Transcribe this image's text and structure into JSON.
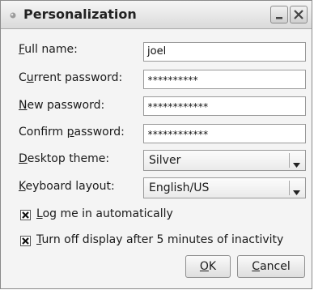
{
  "window": {
    "title": "Personalization",
    "icons": {
      "app": "bullet-icon",
      "minimize": "minimize-icon",
      "close": "close-icon"
    }
  },
  "form": {
    "full_name": {
      "label_mnemonic": "F",
      "label_rest": "ull name:",
      "value": "joel"
    },
    "current_password": {
      "label_pre": "C",
      "label_mnemonic": "u",
      "label_rest": "rrent password:",
      "value": "**********"
    },
    "new_password": {
      "label_mnemonic": "N",
      "label_rest": "ew password:",
      "value": "************"
    },
    "confirm_password": {
      "label_pre": "Confirm ",
      "label_mnemonic": "p",
      "label_rest": "assword:",
      "value": "************"
    },
    "desktop_theme": {
      "label_mnemonic": "D",
      "label_rest": "esktop theme:",
      "value": "Silver"
    },
    "keyboard_layout": {
      "label_mnemonic": "K",
      "label_rest": "eyboard layout:",
      "value": "English/US"
    }
  },
  "options": {
    "auto_login": {
      "label_mnemonic": "L",
      "label_rest": "og me in automatically",
      "checked": true
    },
    "display_off": {
      "label_mnemonic": "T",
      "label_rest": "urn off display after 5 minutes of inactivity",
      "checked": true
    }
  },
  "buttons": {
    "ok": {
      "mnemonic": "O",
      "rest": "K"
    },
    "cancel": {
      "mnemonic": "C",
      "rest": "ancel"
    }
  }
}
